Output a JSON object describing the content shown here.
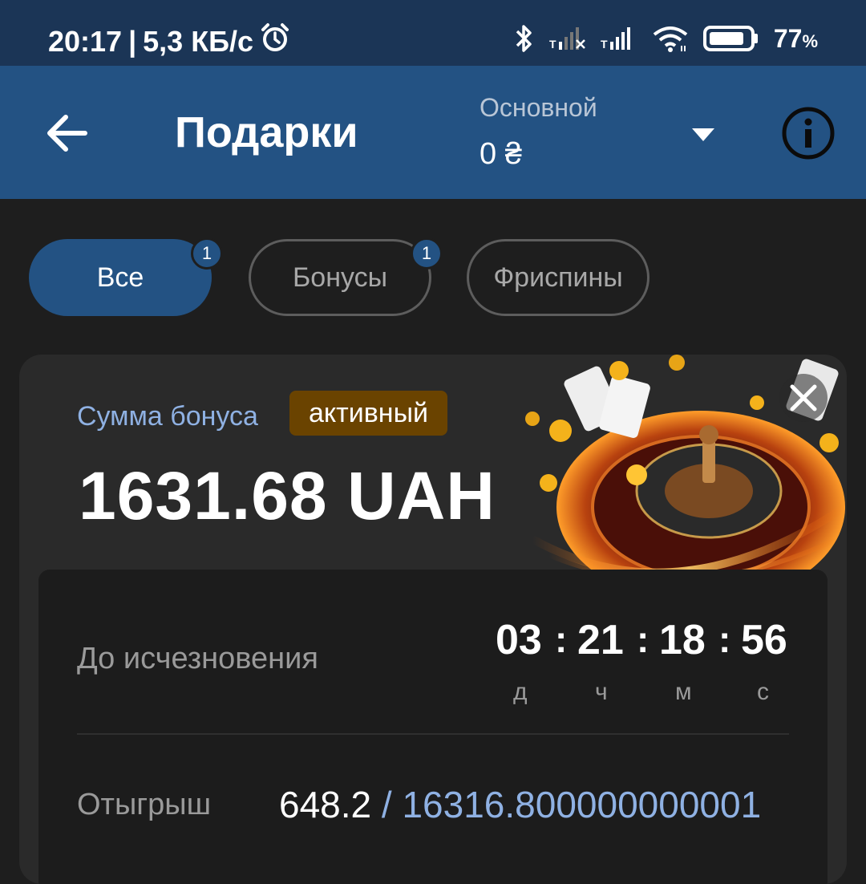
{
  "status_bar": {
    "time": "20:17",
    "network_speed": "5,3 КБ/с",
    "battery": "77",
    "battery_unit": "%",
    "icons": [
      "alarm-icon",
      "bluetooth-icon",
      "signal-icon",
      "signal-icon",
      "wifi-icon",
      "battery-icon"
    ]
  },
  "app_bar": {
    "title": "Подарки",
    "account_label": "Основной",
    "account_balance": "0 ₴",
    "icons": [
      "back-arrow-icon",
      "dropdown-arrow-icon",
      "info-icon"
    ]
  },
  "tabs": [
    {
      "label": "Все",
      "badge": "1",
      "active": true
    },
    {
      "label": "Бонусы",
      "badge": "1",
      "active": false
    },
    {
      "label": "Фриспины",
      "badge": "",
      "active": false
    }
  ],
  "bonus_card": {
    "label": "Сумма бонуса",
    "status": "активный",
    "amount": "1631.68 UAH",
    "expire_label": "До исчезновения",
    "timer": {
      "days": "03",
      "hours": "21",
      "minutes": "18",
      "seconds": "56",
      "separator": ":",
      "units": {
        "days": "д",
        "hours": "ч",
        "minutes": "м",
        "seconds": "с"
      }
    },
    "wager_label": "Отыгрыш",
    "wager_progress": "648.2",
    "wager_separator": "/",
    "wager_total": "16316.800000000001"
  },
  "colors": {
    "status_bar_bg": "#1b3556",
    "app_bar_bg": "#235283",
    "background": "#1e1e1e",
    "accent_blue": "#8fb1e3",
    "status_badge_bg": "#6a4300"
  }
}
